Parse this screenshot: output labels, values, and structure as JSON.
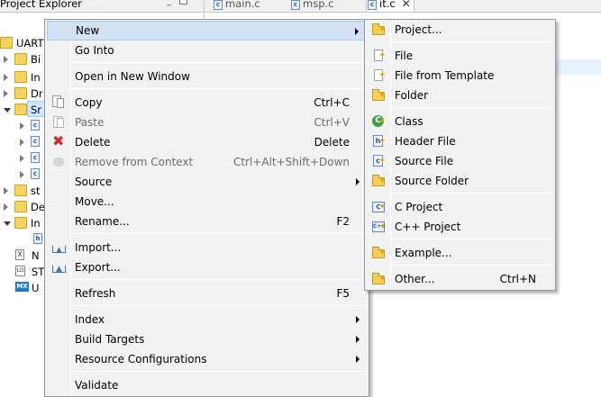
{
  "ide": {
    "view_title": "Project Explorer",
    "editor_tabs": [
      {
        "label": "main.c",
        "active": false
      },
      {
        "label": "msp.c",
        "active": false
      },
      {
        "label": "it.c",
        "active": true
      }
    ],
    "tree": [
      {
        "label": "UART",
        "icon": "project-icon",
        "twisty": "none"
      },
      {
        "label": "Bi",
        "icon": "folder-icon",
        "twisty": "closed"
      },
      {
        "label": "In",
        "icon": "folder-icon",
        "twisty": "closed"
      },
      {
        "label": "Dr",
        "icon": "folder-icon",
        "twisty": "closed"
      },
      {
        "label": "Sr",
        "icon": "folder-icon",
        "twisty": "open"
      },
      {
        "label": "",
        "icon": "c-file-icon",
        "twisty": "closed"
      },
      {
        "label": "",
        "icon": "c-file-icon",
        "twisty": "closed"
      },
      {
        "label": "",
        "icon": "c-file-icon",
        "twisty": "closed"
      },
      {
        "label": "",
        "icon": "c-file-icon",
        "twisty": "closed"
      },
      {
        "label": "st",
        "icon": "folder-icon",
        "twisty": "closed"
      },
      {
        "label": "De",
        "icon": "folder-icon",
        "twisty": "closed"
      },
      {
        "label": "In",
        "icon": "folder-icon",
        "twisty": "open"
      },
      {
        "label": "",
        "icon": "header-file-icon",
        "twisty": "none"
      },
      {
        "label": "N",
        "icon": "xml-file-icon",
        "twisty": "none"
      },
      {
        "label": "ST",
        "icon": "linker-file-icon",
        "twisty": "none"
      },
      {
        "label": "U",
        "icon": "mx-icon",
        "twisty": "none",
        "icon_text": "MX"
      }
    ]
  },
  "context_menu": {
    "items": [
      {
        "label": "New",
        "submenu": true,
        "highlighted": true
      },
      {
        "label": "Go Into"
      },
      {
        "sep": true
      },
      {
        "label": "Open in New Window"
      },
      {
        "sep": true
      },
      {
        "label": "Copy",
        "accel": "Ctrl+C",
        "icon": "copy-icon"
      },
      {
        "label": "Paste",
        "accel": "Ctrl+V",
        "icon": "paste-icon",
        "disabled": true
      },
      {
        "label": "Delete",
        "accel": "Delete",
        "icon": "delete-icon"
      },
      {
        "label": "Remove from Context",
        "accel": "Ctrl+Alt+Shift+Down",
        "icon": "remove-context-icon",
        "disabled": true
      },
      {
        "label": "Source",
        "submenu": true
      },
      {
        "label": "Move..."
      },
      {
        "label": "Rename...",
        "accel": "F2"
      },
      {
        "sep": true
      },
      {
        "label": "Import...",
        "icon": "import-icon"
      },
      {
        "label": "Export...",
        "icon": "export-icon"
      },
      {
        "sep": true
      },
      {
        "label": "Refresh",
        "accel": "F5"
      },
      {
        "sep": true
      },
      {
        "label": "Index",
        "submenu": true
      },
      {
        "label": "Build Targets",
        "submenu": true
      },
      {
        "label": "Resource Configurations",
        "submenu": true
      },
      {
        "sep": true
      },
      {
        "label": "Validate"
      }
    ]
  },
  "new_submenu": {
    "items": [
      {
        "label": "Project...",
        "icon": "new-project-icon"
      },
      {
        "sep": true
      },
      {
        "label": "File",
        "icon": "new-file-icon"
      },
      {
        "label": "File from Template",
        "icon": "file-template-icon"
      },
      {
        "label": "Folder",
        "icon": "folder-icon"
      },
      {
        "sep": true
      },
      {
        "label": "Class",
        "icon": "class-icon",
        "glyph": "C"
      },
      {
        "label": "Header File",
        "icon": "header-file-icon",
        "glyph": "h"
      },
      {
        "label": "Source File",
        "icon": "source-file-icon",
        "glyph": "c"
      },
      {
        "label": "Source Folder",
        "icon": "source-folder-icon"
      },
      {
        "sep": true
      },
      {
        "label": "C Project",
        "icon": "c-project-icon",
        "glyph": "C"
      },
      {
        "label": "C++ Project",
        "icon": "cpp-project-icon",
        "glyph": "C++"
      },
      {
        "sep": true
      },
      {
        "label": "Example...",
        "icon": "example-icon"
      },
      {
        "sep": true
      },
      {
        "label": "Other...",
        "accel": "Ctrl+N",
        "icon": "other-icon"
      }
    ]
  }
}
